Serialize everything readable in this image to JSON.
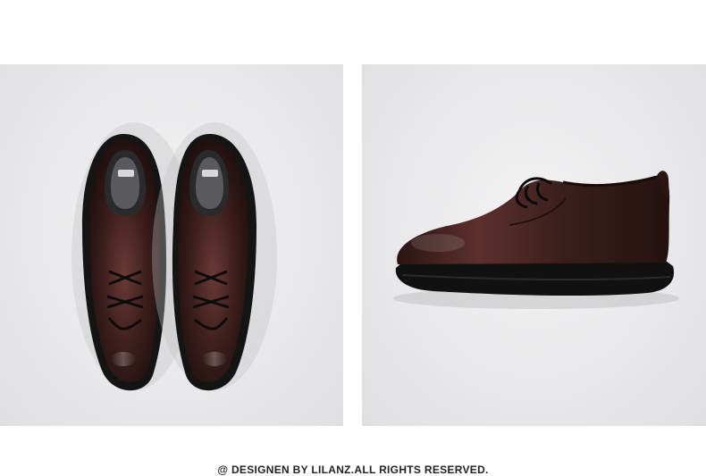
{
  "images": [
    {
      "id": "top-view",
      "subject": "pair-of-brown-leather-derby-shoes-top-view",
      "colors": {
        "leather": "#3a1e1c",
        "sole": "#1a1a1a",
        "background": "#e8e8ea"
      }
    },
    {
      "id": "side-view",
      "subject": "brown-leather-derby-shoe-side-view",
      "colors": {
        "leather": "#3b201e",
        "sole": "#151515",
        "background": "#e8e8ea"
      }
    }
  ],
  "footer": {
    "copyright": "@ DESIGNEN BY LILANZ.ALL RIGHTS RESERVED."
  }
}
